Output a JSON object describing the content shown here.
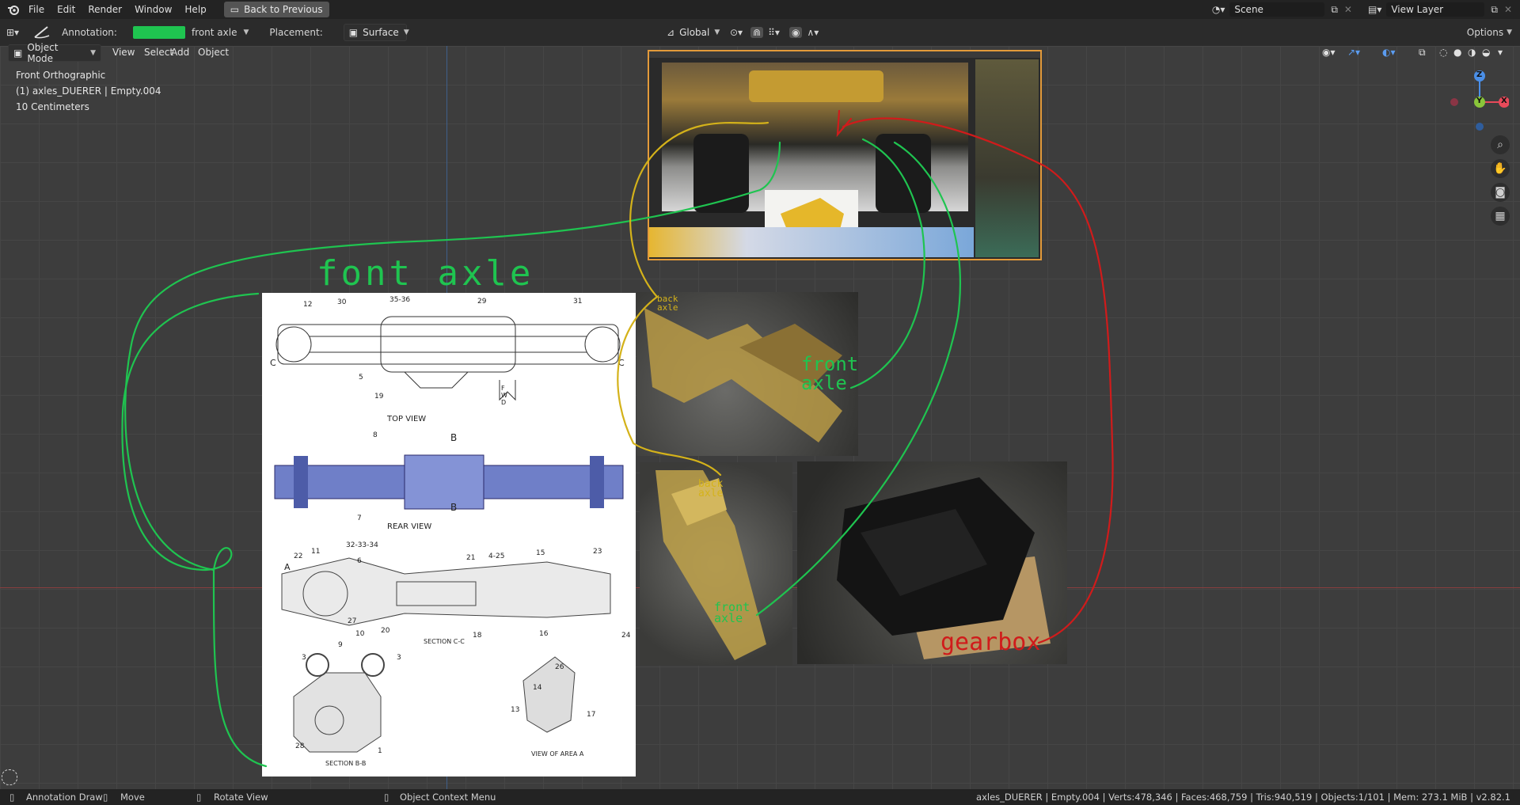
{
  "menus": [
    "File",
    "Edit",
    "Render",
    "Window",
    "Help"
  ],
  "back_button": "Back to Previous",
  "scene": {
    "label": "Scene",
    "view_layer": "View Layer"
  },
  "tool_header": {
    "annotation_label": "Annotation:",
    "annotation_color": "#1fc450",
    "layer_name": "front axle",
    "placement_label": "Placement:",
    "placement_value": "Surface",
    "transform": "Global",
    "options": "Options"
  },
  "viewport_header": {
    "mode": "Object Mode",
    "view": "View",
    "select": "Select",
    "add": "Add",
    "object": "Object"
  },
  "overlay": {
    "view_name": "Front Orthographic",
    "object_info": "(1) axles_DUERER | Empty.004",
    "scale": "10 Centimeters"
  },
  "gizmo": {
    "z": "Z",
    "y": "Y",
    "x": "X"
  },
  "annotations": {
    "front_axle_title": "font axle",
    "front_axle_small": "front axle",
    "front_axle_small2": "front axle",
    "back_axle": "back axle",
    "back_axle2": "back axle",
    "gearbox": "gearbox"
  },
  "drawing": {
    "top_view": "TOP VIEW",
    "rear_view": "REAR VIEW",
    "section_cc": "SECTION C-C",
    "section_bb": "SECTION B-B",
    "view_area": "VIEW OF AREA A",
    "fwd": "FWD",
    "callouts_top": [
      "12",
      "30",
      "35-36",
      "29",
      "31",
      "5",
      "19",
      "C",
      "C"
    ],
    "callouts_rear": [
      "8",
      "B",
      "B",
      "7"
    ],
    "callouts_section": [
      "22",
      "11",
      "32-33-34",
      "6",
      "21",
      "4-25",
      "15",
      "23",
      "A",
      "27",
      "10",
      "20",
      "18",
      "16",
      "24",
      "9"
    ],
    "callouts_bottom": [
      "3",
      "3",
      "28",
      "1",
      "26",
      "14",
      "13",
      "17"
    ]
  },
  "status": {
    "annotation_draw": "Annotation Draw",
    "move": "Move",
    "rotate": "Rotate View",
    "context_menu": "Object Context Menu",
    "stats": "axles_DUERER | Empty.004 | Verts:478,346 | Faces:468,759 | Tris:940,519 | Objects:1/101 | Mem: 273.1 MiB | v2.82.1"
  },
  "colors": {
    "green": "#1fc450",
    "yellow": "#d4b21a",
    "red": "#d01b1b",
    "accent_blue": "#4772b3"
  }
}
